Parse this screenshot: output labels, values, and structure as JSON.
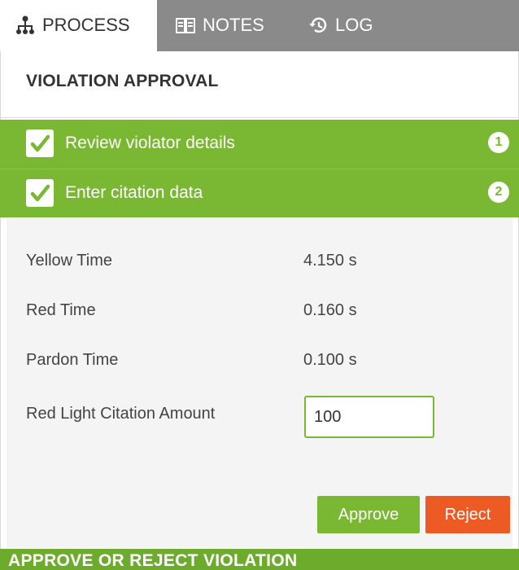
{
  "tabs": [
    {
      "label": "PROCESS",
      "icon": "process-tree-icon",
      "active": true
    },
    {
      "label": "NOTES",
      "icon": "notes-book-icon",
      "active": false
    },
    {
      "label": "LOG",
      "icon": "history-log-icon",
      "active": false
    }
  ],
  "section_title": "VIOLATION APPROVAL",
  "steps": [
    {
      "label": "Review violator details",
      "number": "1",
      "checked": true
    },
    {
      "label": "Enter citation data",
      "number": "2",
      "checked": true
    }
  ],
  "form": {
    "rows": [
      {
        "label": "Yellow Time",
        "value": "4.150 s"
      },
      {
        "label": "Red Time",
        "value": "0.160 s"
      },
      {
        "label": "Pardon Time",
        "value": "0.100 s"
      }
    ],
    "amount_label": "Red Light Citation Amount",
    "amount_value": "100"
  },
  "buttons": {
    "approve": "Approve",
    "reject": "Reject"
  },
  "footer_caption": "APPROVE OR REJECT VIOLATION",
  "colors": {
    "accent_green": "#7ab833",
    "reject_orange": "#ee5a24",
    "tab_bar_gray": "#8a8a8a"
  }
}
